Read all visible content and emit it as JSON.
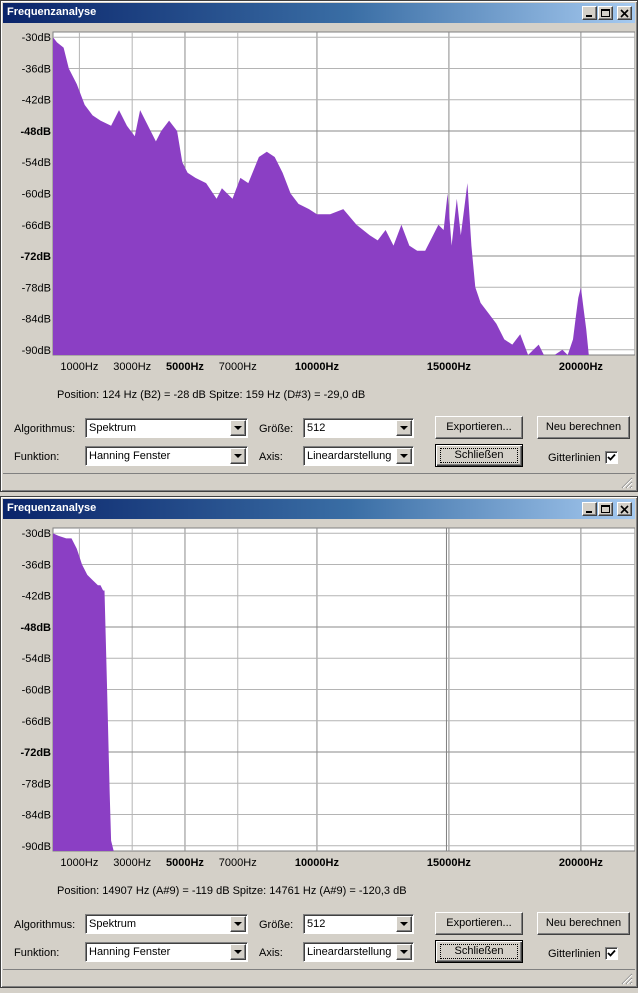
{
  "colors": {
    "spectrum_fill": "#8b3fc4",
    "grid": "#b4b4b4",
    "plot_bg": "#ffffff"
  },
  "icons": {
    "minimize": "minimize-icon",
    "maximize": "maximize-icon",
    "close": "close-icon",
    "dropdown": "chevron-down-icon",
    "check": "check-icon",
    "resize": "resize-grip-icon"
  },
  "windows": [
    {
      "title": "Frequenzanalyse",
      "status": "Position: 124 Hz (B2) = -28 dB   Spitze: 159 Hz (D#3) = -29,0 dB",
      "chart_data": {
        "type": "area",
        "xlabel": "",
        "ylabel": "",
        "xlim": [
          0,
          22050
        ],
        "ylim": [
          -91,
          -29
        ],
        "grid": true,
        "x_ticks": [
          {
            "v": 1000,
            "label": "1000Hz",
            "bold": false
          },
          {
            "v": 3000,
            "label": "3000Hz",
            "bold": false
          },
          {
            "v": 5000,
            "label": "5000Hz",
            "bold": true
          },
          {
            "v": 7000,
            "label": "7000Hz",
            "bold": false
          },
          {
            "v": 10000,
            "label": "10000Hz",
            "bold": true
          },
          {
            "v": 15000,
            "label": "15000Hz",
            "bold": true
          },
          {
            "v": 20000,
            "label": "20000Hz",
            "bold": true
          }
        ],
        "y_ticks": [
          {
            "v": -30,
            "label": "-30dB",
            "bold": false
          },
          {
            "v": -36,
            "label": "-36dB",
            "bold": false
          },
          {
            "v": -42,
            "label": "-42dB",
            "bold": false
          },
          {
            "v": -48,
            "label": "-48dB",
            "bold": true
          },
          {
            "v": -54,
            "label": "-54dB",
            "bold": false
          },
          {
            "v": -60,
            "label": "-60dB",
            "bold": false
          },
          {
            "v": -66,
            "label": "-66dB",
            "bold": false
          },
          {
            "v": -72,
            "label": "-72dB",
            "bold": true
          },
          {
            "v": -78,
            "label": "-78dB",
            "bold": false
          },
          {
            "v": -84,
            "label": "-84dB",
            "bold": false
          },
          {
            "v": -90,
            "label": "-90dB",
            "bold": false
          }
        ],
        "series": [
          {
            "x": [
              0,
              150,
              400,
              600,
              900,
              1200,
              1500,
              1800,
              2200,
              2500,
              2800,
              3100,
              3300,
              3600,
              3900,
              4100,
              4400,
              4700,
              4900,
              5100,
              5400,
              5800,
              6200,
              6400,
              6800,
              7100,
              7400,
              7800,
              8100,
              8400,
              8700,
              9000,
              9300,
              9700,
              10000,
              10500,
              11000,
              11500,
              12000,
              12300,
              12600,
              12900,
              13200,
              13500,
              13800,
              14100,
              14400,
              14600,
              14800,
              14950,
              15100,
              15300,
              15450,
              15600,
              15700,
              15850,
              16000,
              16200,
              16500,
              16800,
              17100,
              17400,
              17700,
              18000,
              18200,
              18400,
              18600,
              18800,
              19000,
              19300,
              19500,
              19700,
              19800,
              19900,
              20000,
              20100,
              20200,
              20300,
              20500,
              22050
            ],
            "y": [
              -30,
              -31,
              -32,
              -36,
              -39,
              -43,
              -45,
              -46,
              -47,
              -44,
              -47,
              -49,
              -44,
              -47,
              -50,
              -48,
              -46,
              -48,
              -54,
              -56,
              -57,
              -58,
              -61,
              -59,
              -61,
              -57,
              -58,
              -53,
              -52,
              -53,
              -56,
              -60,
              -62,
              -63,
              -64,
              -64,
              -63,
              -66,
              -68,
              -69,
              -67,
              -70,
              -66,
              -70,
              -71,
              -71,
              -68,
              -66,
              -67,
              -60,
              -70,
              -61,
              -68,
              -62,
              -58,
              -70,
              -78,
              -81,
              -83,
              -85,
              -88,
              -89,
              -87,
              -91,
              -90,
              -89,
              -91,
              -91,
              -91,
              -90,
              -91,
              -88,
              -84,
              -80,
              -78,
              -82,
              -86,
              -91,
              -91,
              -91
            ]
          }
        ]
      },
      "controls": {
        "algorithm_label": "Algorithmus:",
        "algorithm_value": "Spektrum",
        "function_label": "Funktion:",
        "function_value": "Hanning Fenster",
        "size_label": "Größe:",
        "size_value": "512",
        "axis_label": "Axis:",
        "axis_value": "Lineardarstellung",
        "export_label": "Exportieren...",
        "recalc_label": "Neu berechnen",
        "close_label": "Schließen",
        "grid_label": "Gitterlinien",
        "grid_checked": true
      }
    },
    {
      "title": "Frequenzanalyse",
      "status": "Position: 14907 Hz (A#9) = -119 dB   Spitze: 14761 Hz (A#9) = -120,3 dB",
      "chart_data": {
        "type": "area",
        "xlabel": "",
        "ylabel": "",
        "xlim": [
          0,
          22050
        ],
        "ylim": [
          -91,
          -29
        ],
        "grid": true,
        "x_ticks": [
          {
            "v": 1000,
            "label": "1000Hz",
            "bold": false
          },
          {
            "v": 3000,
            "label": "3000Hz",
            "bold": false
          },
          {
            "v": 5000,
            "label": "5000Hz",
            "bold": true
          },
          {
            "v": 7000,
            "label": "7000Hz",
            "bold": false
          },
          {
            "v": 10000,
            "label": "10000Hz",
            "bold": true
          },
          {
            "v": 15000,
            "label": "15000Hz",
            "bold": true
          },
          {
            "v": 20000,
            "label": "20000Hz",
            "bold": true
          }
        ],
        "y_ticks": [
          {
            "v": -30,
            "label": "-30dB",
            "bold": false
          },
          {
            "v": -36,
            "label": "-36dB",
            "bold": false
          },
          {
            "v": -42,
            "label": "-42dB",
            "bold": false
          },
          {
            "v": -48,
            "label": "-48dB",
            "bold": true
          },
          {
            "v": -54,
            "label": "-54dB",
            "bold": false
          },
          {
            "v": -60,
            "label": "-60dB",
            "bold": false
          },
          {
            "v": -66,
            "label": "-66dB",
            "bold": false
          },
          {
            "v": -72,
            "label": "-72dB",
            "bold": true
          },
          {
            "v": -78,
            "label": "-78dB",
            "bold": false
          },
          {
            "v": -84,
            "label": "-84dB",
            "bold": false
          },
          {
            "v": -90,
            "label": "-90dB",
            "bold": false
          }
        ],
        "series": [
          {
            "x": [
              0,
              200,
              500,
              700,
              900,
              1100,
              1300,
              1500,
              1700,
              1800,
              1900,
              1950,
              2050,
              2150,
              2200,
              2300,
              22050
            ],
            "y": [
              -30,
              -30.5,
              -31,
              -31,
              -33,
              -36,
              -38,
              -39,
              -40,
              -40,
              -41,
              -41,
              -60,
              -80,
              -89,
              -91,
              -91
            ]
          }
        ],
        "marker_x": 14907
      },
      "controls": {
        "algorithm_label": "Algorithmus:",
        "algorithm_value": "Spektrum",
        "function_label": "Funktion:",
        "function_value": "Hanning Fenster",
        "size_label": "Größe:",
        "size_value": "512",
        "axis_label": "Axis:",
        "axis_value": "Lineardarstellung",
        "export_label": "Exportieren...",
        "recalc_label": "Neu berechnen",
        "close_label": "Schließen",
        "grid_label": "Gitterlinien",
        "grid_checked": true
      }
    }
  ]
}
